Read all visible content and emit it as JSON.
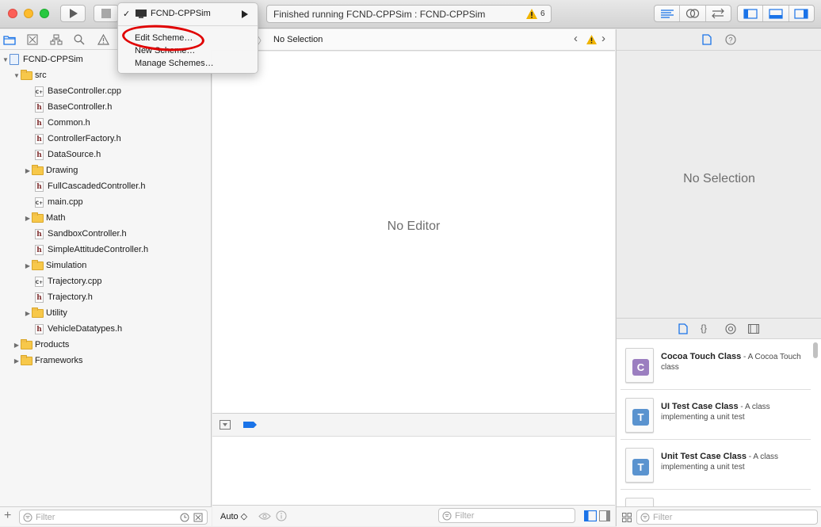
{
  "toolbar": {
    "scheme_name": "FCND-CPPSim",
    "activity_text": "Finished running FCND-CPPSim : FCND-CPPSim",
    "warning_count": "6"
  },
  "scheme_menu": {
    "items": [
      {
        "label": "Edit Scheme…"
      },
      {
        "label": "New Scheme…"
      },
      {
        "label": "Manage Schemes…"
      }
    ]
  },
  "navigator": {
    "tree": [
      {
        "label": "FCND-CPPSim"
      },
      {
        "label": "src"
      },
      {
        "label": "BaseController.cpp"
      },
      {
        "label": "BaseController.h"
      },
      {
        "label": "Common.h"
      },
      {
        "label": "ControllerFactory.h"
      },
      {
        "label": "DataSource.h"
      },
      {
        "label": "Drawing"
      },
      {
        "label": "FullCascadedController.h"
      },
      {
        "label": "main.cpp"
      },
      {
        "label": "Math"
      },
      {
        "label": "SandboxController.h"
      },
      {
        "label": "SimpleAttitudeController.h"
      },
      {
        "label": "Simulation"
      },
      {
        "label": "Trajectory.cpp"
      },
      {
        "label": "Trajectory.h"
      },
      {
        "label": "Utility"
      },
      {
        "label": "VehicleDatatypes.h"
      },
      {
        "label": "Products"
      },
      {
        "label": "Frameworks"
      }
    ],
    "filter_placeholder": "Filter"
  },
  "editor": {
    "jumpbar_text": "No Selection",
    "empty_text": "No Editor"
  },
  "debug": {
    "auto_label": "Auto ◇",
    "filter_placeholder": "Filter"
  },
  "inspector": {
    "empty_text": "No Selection"
  },
  "library": {
    "items": [
      {
        "title": "Cocoa Touch Class",
        "desc": " - A Cocoa Touch class",
        "badge": "C",
        "badge_color": "#9b7ec0"
      },
      {
        "title": "UI Test Case Class",
        "desc": " - A class implementing a unit test",
        "badge": "T",
        "badge_color": "#5a93cf"
      },
      {
        "title": "Unit Test Case Class",
        "desc": " - A class implementing a unit test",
        "badge": "T",
        "badge_color": "#5a93cf"
      }
    ],
    "filter_placeholder": "Filter"
  },
  "colors": {
    "accent": "#1a73e8",
    "annotation": "#e00000",
    "warning": "#f0b400"
  }
}
